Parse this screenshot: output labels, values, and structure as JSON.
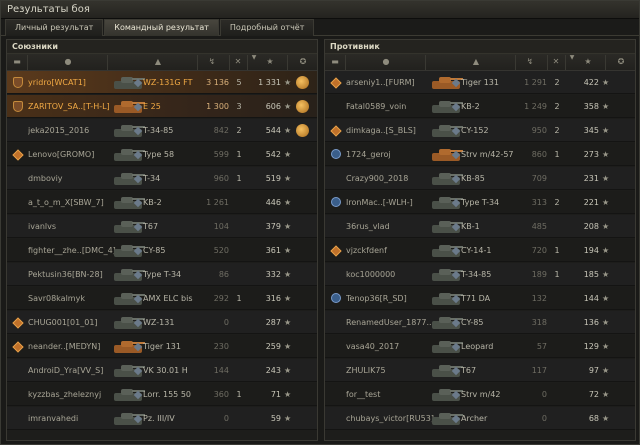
{
  "window": {
    "title": "Результаты боя"
  },
  "tabs": [
    {
      "label": "Личный результат",
      "active": false
    },
    {
      "label": "Командный результат",
      "active": true
    },
    {
      "label": "Подробный отчёт",
      "active": false
    }
  ],
  "columns": {
    "icons": [
      "tank-icon",
      "person-icon",
      "vehicle-icon",
      "damage-icon",
      "kills-icon",
      "sort-icon",
      "star-icon",
      "medal-icon"
    ]
  },
  "allies": {
    "title": "Союзники",
    "rows": [
      {
        "name": "yridro[WCAT1]",
        "tank": "WZ-131G FT",
        "damage": "3 136",
        "kills": "5",
        "xp": "1 331",
        "highlight": true,
        "medal": true,
        "rank": "shield",
        "tank_color": "dark"
      },
      {
        "name": "ZARITOV_SA..[T-H-L]",
        "tank": "E 25",
        "damage": "1 300",
        "kills": "3",
        "xp": "606",
        "highlight": true,
        "medal": true,
        "rank": "shield",
        "tank_color": "orange"
      },
      {
        "name": "jeka2015_2016",
        "tank": "T-34-85",
        "damage": "842",
        "kills": "2",
        "xp": "544",
        "highlight": false,
        "medal": true,
        "rank": "",
        "tank_color": "dark"
      },
      {
        "name": "Lenovo[GROMO]",
        "tank": "Type 58",
        "damage": "599",
        "kills": "1",
        "xp": "542",
        "highlight": false,
        "medal": false,
        "rank": "diamond",
        "tank_color": "dark"
      },
      {
        "name": "dmboviy",
        "tank": "T-34",
        "damage": "960",
        "kills": "1",
        "xp": "519",
        "highlight": false,
        "medal": false,
        "rank": "",
        "tank_color": "dark"
      },
      {
        "name": "a_t_o_m_X[SBW_7]",
        "tank": "KB-2",
        "damage": "1 261",
        "kills": "",
        "xp": "446",
        "highlight": false,
        "medal": false,
        "rank": "",
        "tank_color": "dark"
      },
      {
        "name": "ivanlvs",
        "tank": "T67",
        "damage": "104",
        "kills": "",
        "xp": "379",
        "highlight": false,
        "medal": false,
        "rank": "",
        "tank_color": "dark"
      },
      {
        "name": "fighter__zhe..[DMC_4]",
        "tank": "CY-85",
        "damage": "520",
        "kills": "",
        "xp": "361",
        "highlight": false,
        "medal": false,
        "rank": "",
        "tank_color": "dark"
      },
      {
        "name": "Pektusin36[BN-28]",
        "tank": "Type T-34",
        "damage": "86",
        "kills": "",
        "xp": "332",
        "highlight": false,
        "medal": false,
        "rank": "",
        "tank_color": "dark"
      },
      {
        "name": "Savr08kalmyk",
        "tank": "AMX ELC bis",
        "damage": "292",
        "kills": "1",
        "xp": "316",
        "highlight": false,
        "medal": false,
        "rank": "",
        "tank_color": "dark"
      },
      {
        "name": "CHUG001[01_01]",
        "tank": "WZ-131",
        "damage": "0",
        "kills": "",
        "xp": "287",
        "highlight": false,
        "medal": false,
        "rank": "diamond",
        "tank_color": "dark"
      },
      {
        "name": "neander..[MEDYN]",
        "tank": "Tiger 131",
        "damage": "230",
        "kills": "",
        "xp": "259",
        "highlight": false,
        "medal": false,
        "rank": "diamond",
        "tank_color": "orange"
      },
      {
        "name": "AndroiD_Yra[VV_S]",
        "tank": "VK 30.01 H",
        "damage": "144",
        "kills": "",
        "xp": "243",
        "highlight": false,
        "medal": false,
        "rank": "",
        "tank_color": "dark"
      },
      {
        "name": "kyzzbas_zheleznyj",
        "tank": "Lorr. 155 50",
        "damage": "360",
        "kills": "1",
        "xp": "71",
        "highlight": false,
        "medal": false,
        "rank": "",
        "tank_color": "dark"
      },
      {
        "name": "imranvahedi",
        "tank": "Pz. III/IV",
        "damage": "0",
        "kills": "",
        "xp": "59",
        "highlight": false,
        "medal": false,
        "rank": "",
        "tank_color": "dark"
      }
    ]
  },
  "enemies": {
    "title": "Противник",
    "rows": [
      {
        "name": "arseniy1..[FURM]",
        "tank": "Tiger 131",
        "damage": "1 291",
        "kills": "2",
        "xp": "422",
        "rank": "diamond",
        "tank_color": "orange"
      },
      {
        "name": "Fatal0589_voin",
        "tank": "KB-2",
        "damage": "1 249",
        "kills": "2",
        "xp": "358",
        "rank": "",
        "tank_color": "dark"
      },
      {
        "name": "dimkaga..[S_BLS]",
        "tank": "CY-152",
        "damage": "950",
        "kills": "2",
        "xp": "345",
        "rank": "diamond",
        "tank_color": "dark"
      },
      {
        "name": "1724_geroj",
        "tank": "Strv m/42-57",
        "damage": "860",
        "kills": "1",
        "xp": "273",
        "rank": "clan",
        "tank_color": "orange"
      },
      {
        "name": "Crazy900_2018",
        "tank": "KB-85",
        "damage": "709",
        "kills": "",
        "xp": "231",
        "rank": "",
        "tank_color": "dark"
      },
      {
        "name": "IronMac..[-WLH-]",
        "tank": "Type T-34",
        "damage": "313",
        "kills": "2",
        "xp": "221",
        "rank": "clan",
        "tank_color": "dark"
      },
      {
        "name": "36rus_vlad",
        "tank": "KB-1",
        "damage": "485",
        "kills": "",
        "xp": "208",
        "rank": "",
        "tank_color": "dark"
      },
      {
        "name": "vjzckfdenf",
        "tank": "CY-14-1",
        "damage": "720",
        "kills": "1",
        "xp": "194",
        "rank": "diamond",
        "tank_color": "dark"
      },
      {
        "name": "koc1000000",
        "tank": "T-34-85",
        "damage": "189",
        "kills": "1",
        "xp": "185",
        "rank": "",
        "tank_color": "dark"
      },
      {
        "name": "Tenop36[R_SD]",
        "tank": "T71 DA",
        "damage": "132",
        "kills": "",
        "xp": "144",
        "rank": "clan",
        "tank_color": "dark"
      },
      {
        "name": "RenamedUser_1877..",
        "tank": "CY-85",
        "damage": "318",
        "kills": "",
        "xp": "136",
        "rank": "",
        "tank_color": "dark"
      },
      {
        "name": "vasa40_2017",
        "tank": "Leopard",
        "damage": "57",
        "kills": "",
        "xp": "129",
        "rank": "",
        "tank_color": "dark"
      },
      {
        "name": "ZHULIK75",
        "tank": "T67",
        "damage": "117",
        "kills": "",
        "xp": "97",
        "rank": "",
        "tank_color": "dark"
      },
      {
        "name": "for__test",
        "tank": "Strv m/42",
        "damage": "0",
        "kills": "",
        "xp": "72",
        "rank": "",
        "tank_color": "dark"
      },
      {
        "name": "chubays_victor[RU53]",
        "tank": "Archer",
        "damage": "0",
        "kills": "",
        "xp": "68",
        "rank": "",
        "tank_color": "dark"
      }
    ]
  },
  "colors": {
    "highlight": "#f0a944",
    "self_row": "#5b3a1c",
    "panel_bg": "#1d1d1b"
  }
}
